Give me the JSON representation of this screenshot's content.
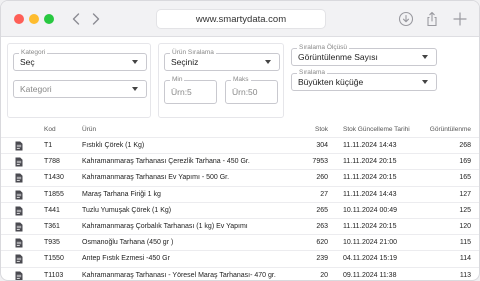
{
  "browser": {
    "url": "www.smartydata.com",
    "icons": [
      "back-icon",
      "forward-icon",
      "download-icon",
      "share-icon",
      "new-tab-icon"
    ]
  },
  "filters": {
    "kategori_select": {
      "legend": "Kategori",
      "value": "Seç"
    },
    "kategori_input": {
      "placeholder": "Kategori"
    },
    "urun_siralama": {
      "legend": "Ürün Sıralama",
      "value": "Seçiniz"
    },
    "min": {
      "legend": "Min",
      "placeholder": "Ürn:5"
    },
    "maks": {
      "legend": "Maks",
      "placeholder": "Ürn:50"
    },
    "siralama_olcusu": {
      "legend": "Sıralama Ölçüsü",
      "value": "Görüntülenme Sayısı"
    },
    "siralama": {
      "legend": "Sıralama",
      "value": "Büyükten küçüğe"
    }
  },
  "table": {
    "headers": {
      "kod": "Kod",
      "urun": "Ürün",
      "stok": "Stok",
      "tarih": "Stok Güncelleme Tarihi",
      "gor": "Görüntülenme"
    },
    "rows": [
      {
        "kod": "T1",
        "urun": "Fıstıklı Çörek (1 Kg)",
        "stok": "304",
        "tarih": "11.11.2024 14:43",
        "gor": "268"
      },
      {
        "kod": "T788",
        "urun": "Kahramanmaraş Tarhanası Çerezlik Tarhana - 450 Gr.",
        "stok": "7953",
        "tarih": "11.11.2024 20:15",
        "gor": "169"
      },
      {
        "kod": "T1430",
        "urun": "Kahramanmaraş Tarhanası Ev Yapımı - 500 Gr.",
        "stok": "260",
        "tarih": "11.11.2024 20:15",
        "gor": "165"
      },
      {
        "kod": "T1855",
        "urun": "Maraş Tarhana Firiği 1 kg",
        "stok": "27",
        "tarih": "11.11.2024 14:43",
        "gor": "127"
      },
      {
        "kod": "T441",
        "urun": "Tuzlu Yumuşak Çörek (1 Kg)",
        "stok": "265",
        "tarih": "10.11.2024 00:49",
        "gor": "125"
      },
      {
        "kod": "T361",
        "urun": "Kahramanmaraş Çorbalık Tarhanası (1 kg) Ev Yapımı",
        "stok": "263",
        "tarih": "11.11.2024 20:15",
        "gor": "120"
      },
      {
        "kod": "T935",
        "urun": "Osmanoğlu Tarhana (450 gr )",
        "stok": "620",
        "tarih": "10.11.2024 21:00",
        "gor": "115"
      },
      {
        "kod": "T1550",
        "urun": "Antep Fıstık Ezmesi -450 Gr",
        "stok": "239",
        "tarih": "04.11.2024 15:19",
        "gor": "114"
      },
      {
        "kod": "T1103",
        "urun": "Kahramanmaraş Tarhanası - Yöresel Maraş Tarhanası- 470 gr.",
        "stok": "20",
        "tarih": "09.11.2024 11:38",
        "gor": "113"
      }
    ]
  }
}
